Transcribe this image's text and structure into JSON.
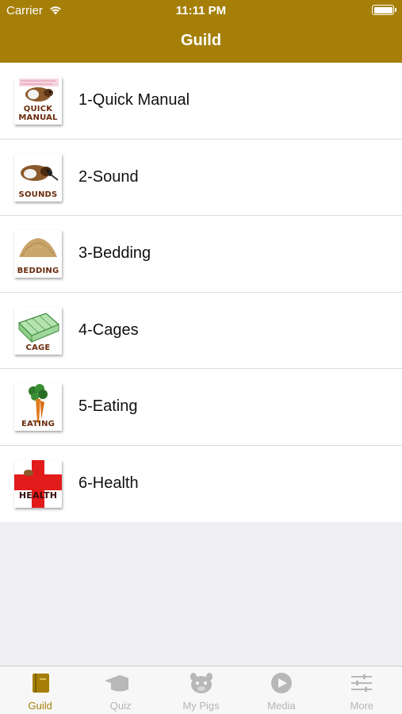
{
  "status_bar": {
    "carrier": "Carrier",
    "time": "11:11 PM"
  },
  "nav": {
    "title": "Guild"
  },
  "items": [
    {
      "label": "1-Quick Manual",
      "thumb_text": "QUICK MANUAL",
      "icon": "guinea-pig-manual-icon"
    },
    {
      "label": "2-Sound",
      "thumb_text": "SOUNDS",
      "icon": "guinea-pig-microphone-icon"
    },
    {
      "label": "3-Bedding",
      "thumb_text": "BEDDING",
      "icon": "bedding-pile-icon"
    },
    {
      "label": "4-Cages",
      "thumb_text": "CAGE",
      "icon": "cage-icon"
    },
    {
      "label": "5-Eating",
      "thumb_text": "EATING",
      "icon": "carrot-icon"
    },
    {
      "label": "6-Health",
      "thumb_text": "HEALTH",
      "icon": "red-cross-icon"
    }
  ],
  "tabs": [
    {
      "label": "Guild",
      "icon": "book-icon",
      "active": true
    },
    {
      "label": "Quiz",
      "icon": "graduation-cap-icon",
      "active": false
    },
    {
      "label": "My Pigs",
      "icon": "pig-face-icon",
      "active": false
    },
    {
      "label": "Media",
      "icon": "play-circle-icon",
      "active": false
    },
    {
      "label": "More",
      "icon": "sliders-icon",
      "active": false
    }
  ],
  "colors": {
    "accent": "#a57f08",
    "inactive": "#b5b5b5",
    "thumb_text": "#6a2b0c"
  }
}
